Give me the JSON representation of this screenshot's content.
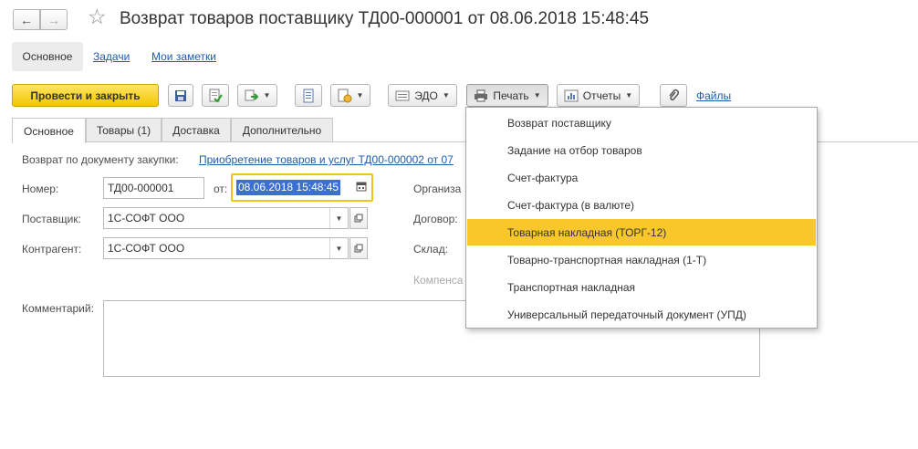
{
  "window": {
    "title": "Возврат товаров поставщику ТД00-000001 от 08.06.2018 15:48:45"
  },
  "subnav": {
    "main": "Основное",
    "tasks": "Задачи",
    "notes": "Мои заметки"
  },
  "toolbar": {
    "post_close": "Провести и закрыть",
    "edo": "ЭДО",
    "print": "Печать",
    "reports": "Отчеты",
    "files": "Файлы"
  },
  "tabs": [
    {
      "label": "Основное",
      "active": true
    },
    {
      "label": "Товары (1)",
      "active": false
    },
    {
      "label": "Доставка",
      "active": false
    },
    {
      "label": "Дополнительно",
      "active": false
    }
  ],
  "form": {
    "return_basis_label": "Возврат по документу закупки:",
    "return_basis_link": "Приобретение товаров и услуг ТД00-000002 от 07",
    "number_label": "Номер:",
    "number_value": "ТД00-000001",
    "date_label": "от:",
    "date_value": "08.06.2018 15:48:45",
    "supplier_label": "Поставщик:",
    "supplier_value": "1С-СОФТ ООО",
    "counterparty_label": "Контрагент:",
    "counterparty_value": "1С-СОФТ ООО",
    "org_label": "Организа",
    "contract_label": "Договор:",
    "warehouse_label": "Склад:",
    "compensation_label": "Компенса",
    "comment_label": "Комментарий:"
  },
  "print_menu": {
    "items": [
      "Возврат поставщику",
      "Задание на отбор товаров",
      "Счет-фактура",
      "Счет-фактура (в валюте)",
      "Товарная накладная (ТОРГ-12)",
      "Товарно-транспортная накладная (1-Т)",
      "Транспортная накладная",
      "Универсальный передаточный документ (УПД)"
    ],
    "highlighted": "Товарная накладная (ТОРГ-12)"
  },
  "colors": {
    "accent_yellow": "#f8c82b",
    "link_blue": "#1d5cab",
    "selection_blue": "#3b6fd1"
  }
}
